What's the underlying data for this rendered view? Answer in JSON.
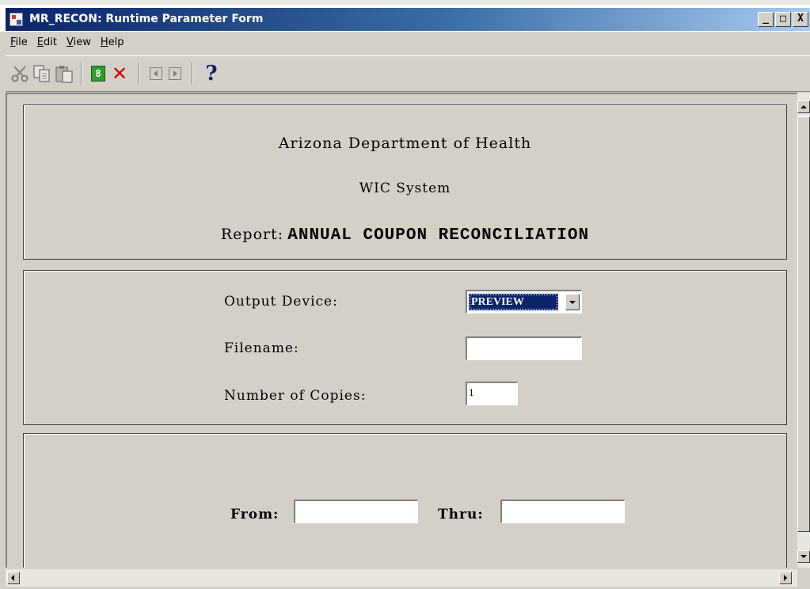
{
  "window": {
    "title": "MR_RECON: Runtime Parameter Form",
    "minimize": "_",
    "maximize": "□",
    "close": "X"
  },
  "menu": [
    {
      "pre": "",
      "key": "F",
      "post": "ile"
    },
    {
      "pre": "",
      "key": "E",
      "post": "dit"
    },
    {
      "pre": "",
      "key": "V",
      "post": "iew"
    },
    {
      "pre": "",
      "key": "H",
      "post": "elp"
    }
  ],
  "toolbar": {
    "icons": [
      "cut-icon",
      "copy-icon",
      "paste-icon",
      "run-report-icon",
      "cancel-icon",
      "previous-page-icon",
      "next-page-icon",
      "help-icon"
    ],
    "run_glyph": "8",
    "cancel_glyph": "✕",
    "help_glyph": "?",
    "cancel_color": "#d20000",
    "help_color": "#0a246a"
  },
  "header": {
    "line1": "Arizona Department of Health",
    "line2": "WIC System",
    "report_label": "Report:",
    "report_name": "ANNUAL COUPON RECONCILIATION"
  },
  "params": {
    "output_device_label": "Output Device:",
    "output_device_value": "PREVIEW",
    "filename_label": "Filename:",
    "filename_value": "",
    "copies_label": "Number of Copies:",
    "copies_value": "1"
  },
  "dates": {
    "from_label": "From:",
    "from_value": "",
    "thru_label": "Thru:",
    "thru_value": ""
  },
  "colors": {
    "face": "#d4d0c8",
    "title_start": "#0a246a",
    "title_end": "#a6caf0",
    "selection": "#0a246a"
  }
}
